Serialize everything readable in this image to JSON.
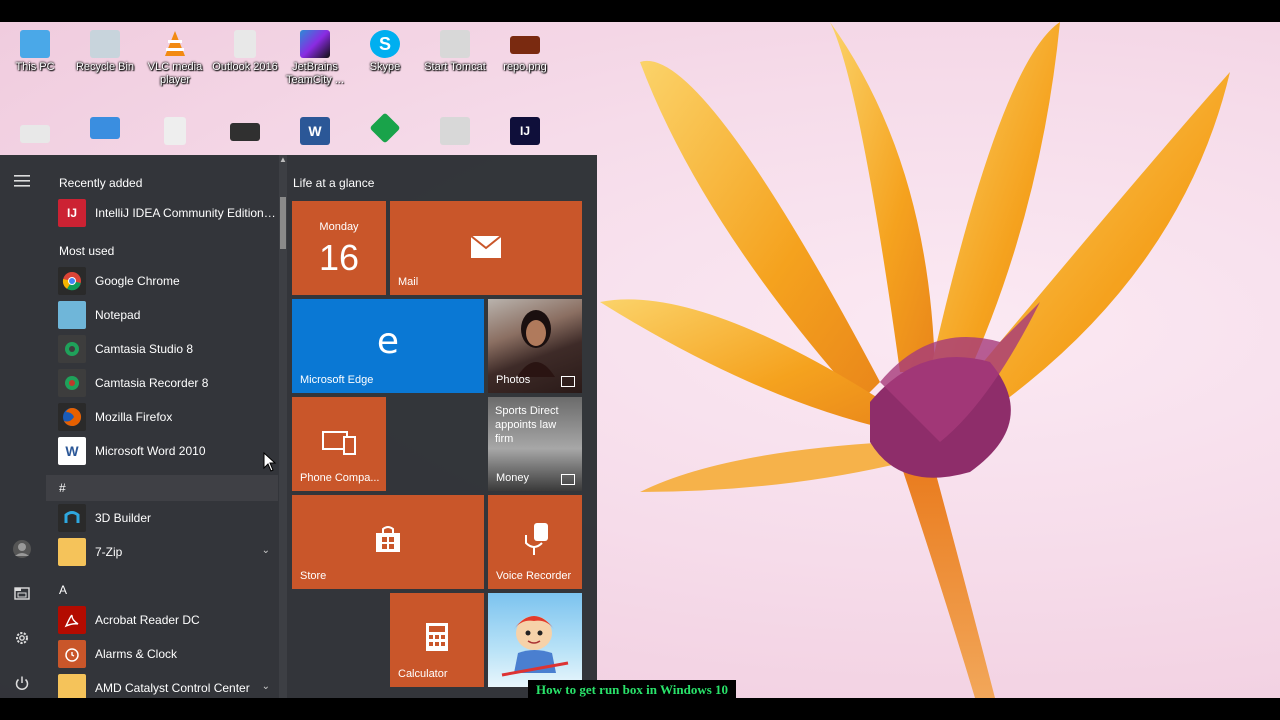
{
  "desktop": {
    "icons": [
      {
        "label": "This PC",
        "icon": "computer-icon",
        "color": "#4aa8e8"
      },
      {
        "label": "Recycle Bin",
        "icon": "recycle-bin-icon",
        "color": "#c8d4dc"
      },
      {
        "label": "VLC media player",
        "icon": "vlc-cone-icon",
        "color": "#f28a12"
      },
      {
        "label": "Outlook 2016",
        "icon": "shortcut-file-icon",
        "color": "#e8e8e8"
      },
      {
        "label": "JetBrains TeamCity ...",
        "icon": "teamcity-icon",
        "color": "#2c8bd6"
      },
      {
        "label": "Skype",
        "icon": "skype-icon",
        "color": "#00aff0"
      },
      {
        "label": "Start Tomcat",
        "icon": "gears-icon",
        "color": "#d8d8d8"
      },
      {
        "label": "repo.png",
        "icon": "image-file-icon",
        "color": "#7a2a10"
      }
    ],
    "icons_row2": [
      {
        "icon": "folder-icon",
        "color": "#e8e8e8"
      },
      {
        "icon": "window-icon",
        "color": "#3a8ee0"
      },
      {
        "icon": "shortcut-file-icon",
        "color": "#eeeeee"
      },
      {
        "icon": "video-file-icon",
        "color": "#303030"
      },
      {
        "icon": "word-doc-icon",
        "color": "#2b5797"
      },
      {
        "icon": "green-arrow-icon",
        "color": "#19a34a"
      },
      {
        "icon": "gears-icon",
        "color": "#d8d8d8"
      },
      {
        "icon": "intellij-icon",
        "color": "#0f0f3a"
      }
    ]
  },
  "start_menu": {
    "rail_icons": [
      "hamburger-icon",
      "user-avatar-icon",
      "file-explorer-icon",
      "settings-icon",
      "power-icon"
    ],
    "recently_added_header": "Recently added",
    "recently_added": [
      {
        "label": "IntelliJ IDEA Community Edition 2...",
        "icon": "intellij-icon",
        "color": "#cc2233",
        "glyph": "IJ"
      }
    ],
    "most_used_header": "Most used",
    "most_used": [
      {
        "label": "Google Chrome",
        "icon": "chrome-icon",
        "color": "#2a2a2a"
      },
      {
        "label": "Notepad",
        "icon": "notepad-icon",
        "color": "#6fb6d9"
      },
      {
        "label": "Camtasia Studio 8",
        "icon": "camtasia-icon",
        "color": "#3d3d3d"
      },
      {
        "label": "Camtasia Recorder 8",
        "icon": "camtasia-recorder-icon",
        "color": "#3d3d3d"
      },
      {
        "label": "Mozilla Firefox",
        "icon": "firefox-icon",
        "color": "#e66000"
      },
      {
        "label": "Microsoft Word 2010",
        "icon": "word-icon",
        "color": "#2b5797"
      }
    ],
    "hash_header": "#",
    "hash_apps": [
      {
        "label": "3D Builder",
        "icon": "3d-builder-icon",
        "color": "#2a2a2a",
        "expand": false
      },
      {
        "label": "7-Zip",
        "icon": "folder-icon",
        "color": "#f5c35a",
        "expand": true
      }
    ],
    "a_header": "A",
    "a_apps": [
      {
        "label": "Acrobat Reader DC",
        "icon": "acrobat-icon",
        "color": "#b30b00",
        "expand": false
      },
      {
        "label": "Alarms & Clock",
        "icon": "alarm-clock-icon",
        "color": "#c9562a",
        "expand": false
      },
      {
        "label": "AMD Catalyst Control Center",
        "icon": "folder-icon",
        "color": "#f5c35a",
        "expand": true
      }
    ],
    "tiles_header": "Life at a glance",
    "tiles": {
      "calendar_day": "Monday",
      "calendar_date": "16",
      "mail": "Mail",
      "edge": "Microsoft Edge",
      "photos": "Photos",
      "phone": "Phone Compa...",
      "money_headline": "Sports Direct appoints law firm",
      "money": "Money",
      "store": "Store",
      "voice": "Voice Recorder",
      "calculator": "Calculator"
    },
    "colors": {
      "tile_orange": "#c9562a",
      "tile_blue": "#0a78d4"
    }
  },
  "caption": "How to get run box in Windows 10"
}
